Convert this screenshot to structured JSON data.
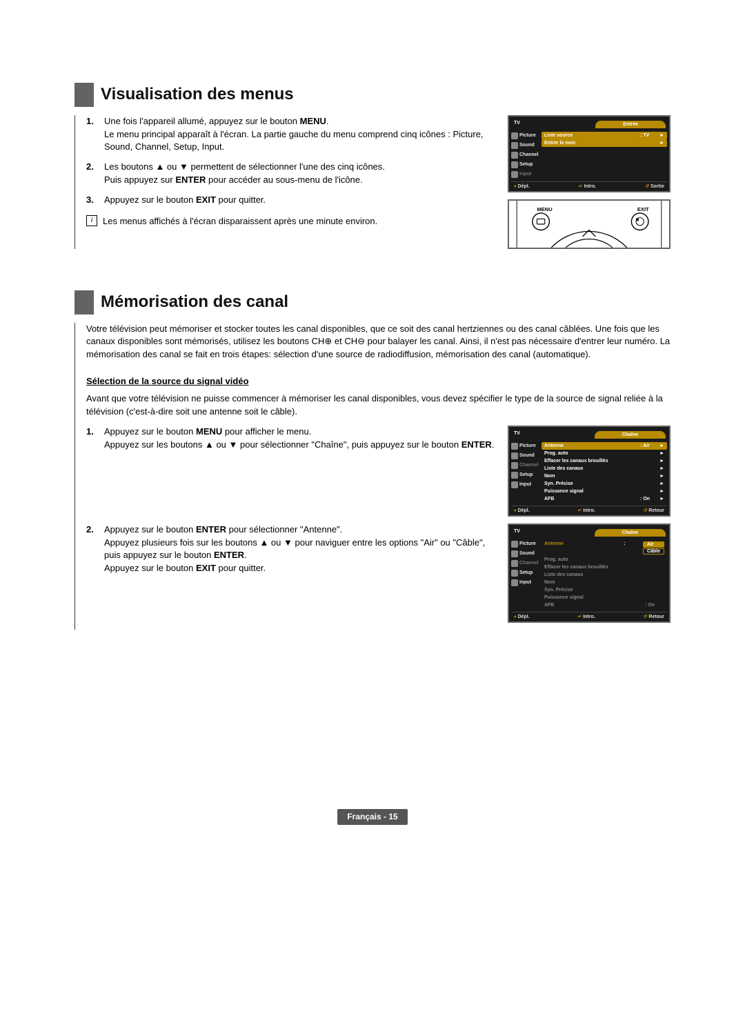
{
  "section1": {
    "heading": "Visualisation des menus",
    "step1_num": "1.",
    "step1_a": "Une fois l'appareil allumé, appuyez sur le bouton ",
    "step1_b": "MENU",
    "step1_c": ".",
    "step1_line2": "Le menu principal apparaît à l'écran. La partie gauche du menu comprend cinq icônes : Picture, Sound, Channel, Setup, Input.",
    "step2_num": "2.",
    "step2_a": "Les boutons ▲ ou ▼ permettent de sélectionner l'une des cinq icônes.",
    "step2_b_a": "Puis appuyez sur ",
    "step2_b_b": "ENTER",
    "step2_b_c": " pour accéder au sous-menu de l'icône.",
    "step3_num": "3.",
    "step3_a": "Appuyez sur le bouton ",
    "step3_b": "EXIT",
    "step3_c": " pour quitter.",
    "note_icon": "i",
    "note": "Les menus affichés à l'écran disparaissent après une minute environ."
  },
  "osd1": {
    "tv": "TV",
    "title": "Entrée",
    "icons": [
      "Picture",
      "Sound",
      "Channel",
      "Setup",
      "Input"
    ],
    "rows": [
      {
        "label": "Liste source",
        "val": ": TV",
        "arrow": "►"
      },
      {
        "label": "Entrer le nom",
        "val": "",
        "arrow": "►"
      }
    ],
    "footer": {
      "move": "Dépl.",
      "enter": "Intro.",
      "exit": "Sortie"
    }
  },
  "remote": {
    "menu": "MENU",
    "exit": "EXIT"
  },
  "section2": {
    "heading": "Mémorisation des canal",
    "intro": "Votre télévision peut mémoriser et stocker toutes les canal disponibles, que ce soit des canal hertziennes ou des canal câblées. Une fois que les canaux disponibles sont mémorisés, utilisez les boutons CH⊕ et CH⊖ pour balayer les canal. Ainsi, il n'est pas nécessaire d'entrer leur numéro. La mémorisation des canal se fait en trois étapes: sélection d'une source de radiodiffusion, mémorisation des canal (automatique).",
    "subhead": "Sélection de la source du signal vidéo",
    "subintro": "Avant que votre télévision ne puisse commencer à mémoriser les canal disponibles, vous devez spécifier le type de la source de signal reliée à la télévision (c'est-à-dire soit une antenne soit le câble).",
    "s1_num": "1.",
    "s1_a": "Appuyez sur le bouton ",
    "s1_b": "MENU",
    "s1_c": " pour afficher le menu.",
    "s1_line2_a": "Appuyez sur les boutons ▲ ou ▼ pour sélectionner \"Chaîne\", puis appuyez sur le bouton ",
    "s1_line2_b": "ENTER",
    "s1_line2_c": ".",
    "s2_num": "2.",
    "s2_a": "Appuyez sur le bouton ",
    "s2_b": "ENTER",
    "s2_c": " pour sélectionner \"Antenne\".",
    "s2_line2_a": "Appuyez plusieurs fois sur les boutons ▲ ou ▼ pour naviguer entre les options \"Air\" ou \"Câble\", puis appuyez sur le bouton ",
    "s2_line2_b": "ENTER",
    "s2_line2_c": ".",
    "s2_line3_a": "Appuyez sur le bouton ",
    "s2_line3_b": "EXIT",
    "s2_line3_c": " pour quitter."
  },
  "osd2": {
    "tv": "TV",
    "title": "Chaîne",
    "icons": [
      "Picture",
      "Sound",
      "Channel",
      "Setup",
      "Input"
    ],
    "rows": [
      {
        "label": "Antenne",
        "val": ": Air",
        "arrow": "►",
        "hl": true
      },
      {
        "label": "Prog. auto",
        "val": "",
        "arrow": "►"
      },
      {
        "label": "Effacer les canaux brouillés",
        "val": "",
        "arrow": "►"
      },
      {
        "label": "Liste des canaux",
        "val": "",
        "arrow": "►"
      },
      {
        "label": "Nom",
        "val": "",
        "arrow": "►"
      },
      {
        "label": "Syn. Précise",
        "val": "",
        "arrow": "►"
      },
      {
        "label": "Puissance signal",
        "val": "",
        "arrow": "►"
      },
      {
        "label": "AFB",
        "val": ": On",
        "arrow": "►"
      }
    ],
    "footer": {
      "move": "Dépl.",
      "enter": "Intro.",
      "exit": "Retour"
    }
  },
  "osd3": {
    "tv": "TV",
    "title": "Chaîne",
    "icons": [
      "Picture",
      "Sound",
      "Channel",
      "Setup",
      "Input"
    ],
    "sel": [
      "Air",
      "Câble"
    ],
    "rows": [
      {
        "label": "Antenne",
        "val": ":",
        "hl": true
      },
      {
        "label": "Prog. auto",
        "dim": true
      },
      {
        "label": "Effacer les canaux brouillés",
        "dim": true
      },
      {
        "label": "Liste des canaux",
        "dim": true
      },
      {
        "label": "Nom",
        "dim": true
      },
      {
        "label": "Syn. Précise",
        "dim": true
      },
      {
        "label": "Puissance signal",
        "dim": true
      },
      {
        "label": "AFB",
        "val": ": On",
        "dim": true
      }
    ],
    "footer": {
      "move": "Dépl.",
      "enter": "Intro.",
      "exit": "Retour"
    }
  },
  "footer": "Français - 15"
}
